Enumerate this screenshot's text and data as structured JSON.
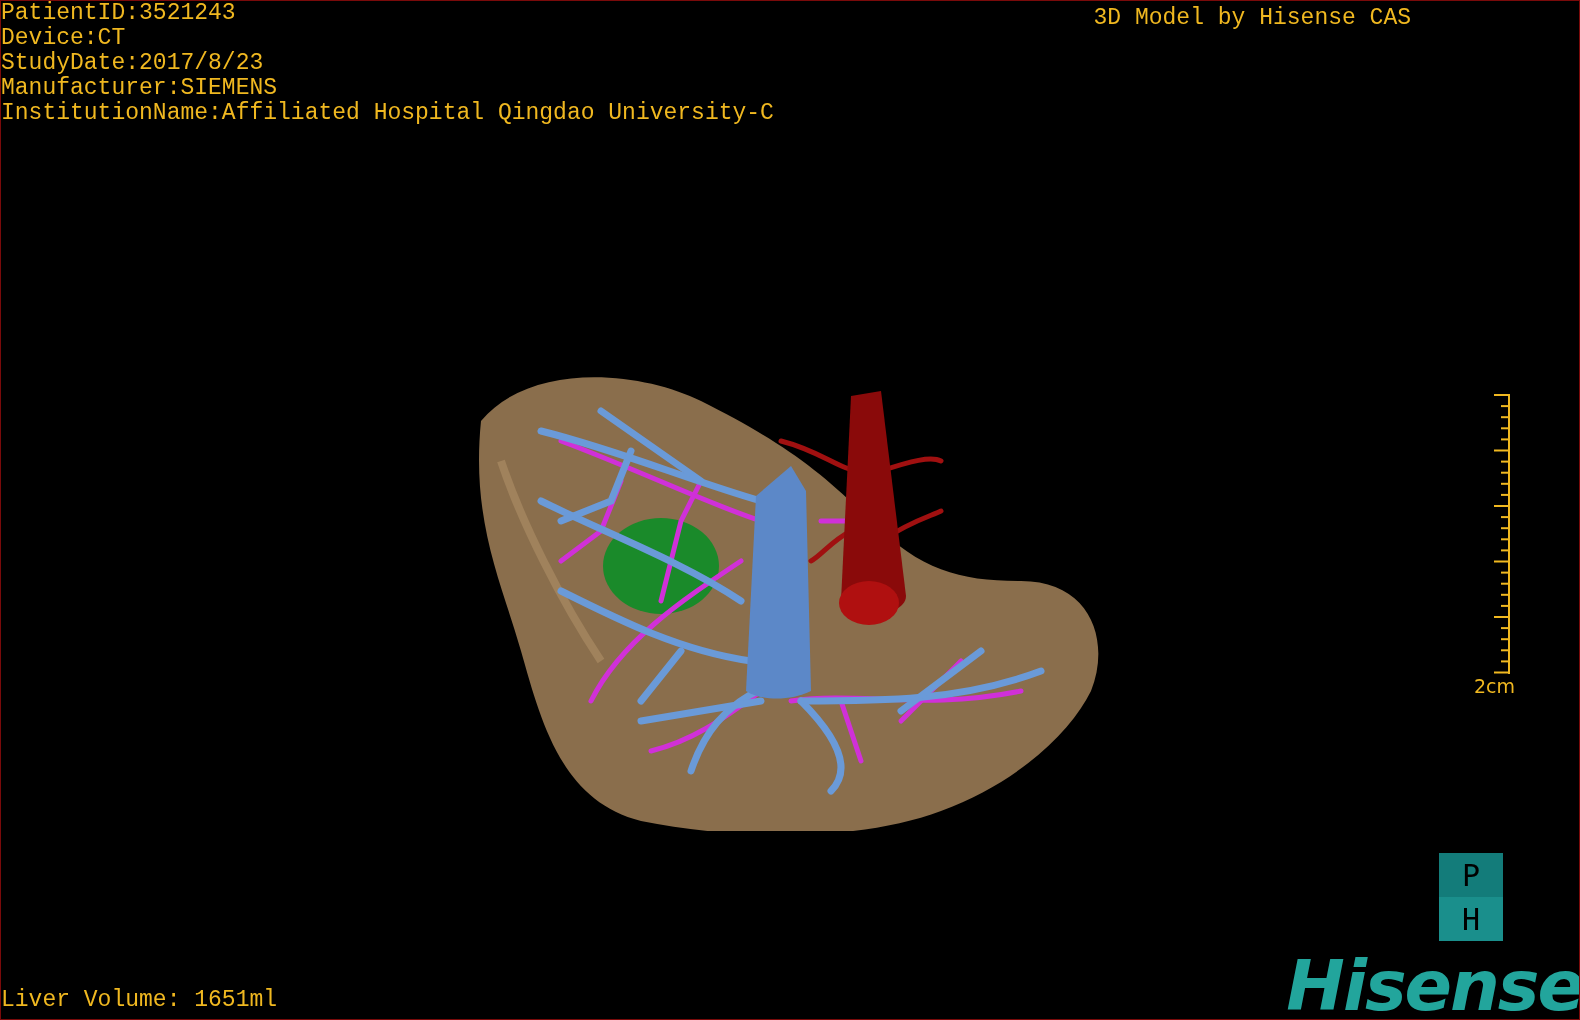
{
  "info_lines": [
    "PatientID:3521243",
    "Device:CT",
    "StudyDate:2017/8/23",
    "Manufacturer:SIEMENS",
    "InstitutionName:Affiliated Hospital Qingdao University-C"
  ],
  "title": "3D Model by Hisense CAS",
  "scale": {
    "label": "2cm"
  },
  "liver_volume": "Liver Volume: 1651ml",
  "logo": {
    "badge_letters": [
      "P",
      "H"
    ],
    "wordmark": "Hisense"
  }
}
